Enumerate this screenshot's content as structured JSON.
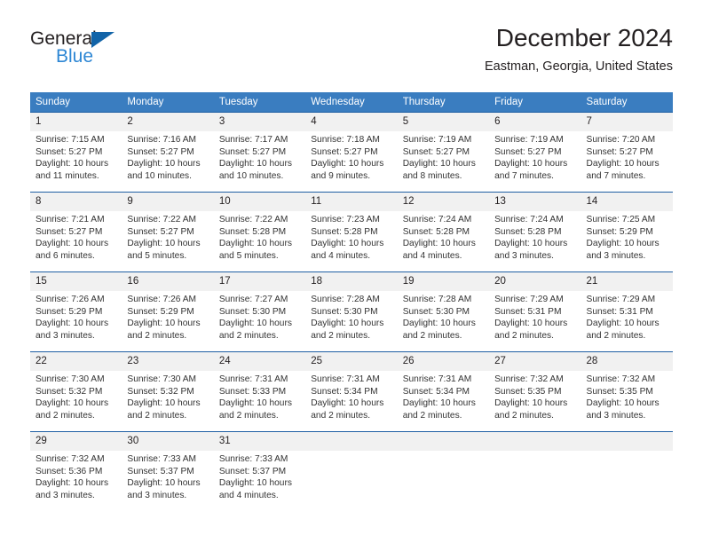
{
  "brand": {
    "name_part1": "General",
    "name_part2": "Blue",
    "logo_icon": "triangle-logo-icon",
    "accent_color": "#1264a8",
    "secondary_color": "#2e87d4"
  },
  "header": {
    "title": "December 2024",
    "location": "Eastman, Georgia, United States"
  },
  "calendar": {
    "header_bg_color": "#3a7dc0",
    "row_divider_color": "#1f5fa3",
    "daynum_bg_color": "#f1f1f1",
    "weekday_headers": [
      "Sunday",
      "Monday",
      "Tuesday",
      "Wednesday",
      "Thursday",
      "Friday",
      "Saturday"
    ],
    "weeks": [
      [
        {
          "day": "1",
          "sunrise": "Sunrise: 7:15 AM",
          "sunset": "Sunset: 5:27 PM",
          "daylight_line1": "Daylight: 10 hours",
          "daylight_line2": "and 11 minutes."
        },
        {
          "day": "2",
          "sunrise": "Sunrise: 7:16 AM",
          "sunset": "Sunset: 5:27 PM",
          "daylight_line1": "Daylight: 10 hours",
          "daylight_line2": "and 10 minutes."
        },
        {
          "day": "3",
          "sunrise": "Sunrise: 7:17 AM",
          "sunset": "Sunset: 5:27 PM",
          "daylight_line1": "Daylight: 10 hours",
          "daylight_line2": "and 10 minutes."
        },
        {
          "day": "4",
          "sunrise": "Sunrise: 7:18 AM",
          "sunset": "Sunset: 5:27 PM",
          "daylight_line1": "Daylight: 10 hours",
          "daylight_line2": "and 9 minutes."
        },
        {
          "day": "5",
          "sunrise": "Sunrise: 7:19 AM",
          "sunset": "Sunset: 5:27 PM",
          "daylight_line1": "Daylight: 10 hours",
          "daylight_line2": "and 8 minutes."
        },
        {
          "day": "6",
          "sunrise": "Sunrise: 7:19 AM",
          "sunset": "Sunset: 5:27 PM",
          "daylight_line1": "Daylight: 10 hours",
          "daylight_line2": "and 7 minutes."
        },
        {
          "day": "7",
          "sunrise": "Sunrise: 7:20 AM",
          "sunset": "Sunset: 5:27 PM",
          "daylight_line1": "Daylight: 10 hours",
          "daylight_line2": "and 7 minutes."
        }
      ],
      [
        {
          "day": "8",
          "sunrise": "Sunrise: 7:21 AM",
          "sunset": "Sunset: 5:27 PM",
          "daylight_line1": "Daylight: 10 hours",
          "daylight_line2": "and 6 minutes."
        },
        {
          "day": "9",
          "sunrise": "Sunrise: 7:22 AM",
          "sunset": "Sunset: 5:27 PM",
          "daylight_line1": "Daylight: 10 hours",
          "daylight_line2": "and 5 minutes."
        },
        {
          "day": "10",
          "sunrise": "Sunrise: 7:22 AM",
          "sunset": "Sunset: 5:28 PM",
          "daylight_line1": "Daylight: 10 hours",
          "daylight_line2": "and 5 minutes."
        },
        {
          "day": "11",
          "sunrise": "Sunrise: 7:23 AM",
          "sunset": "Sunset: 5:28 PM",
          "daylight_line1": "Daylight: 10 hours",
          "daylight_line2": "and 4 minutes."
        },
        {
          "day": "12",
          "sunrise": "Sunrise: 7:24 AM",
          "sunset": "Sunset: 5:28 PM",
          "daylight_line1": "Daylight: 10 hours",
          "daylight_line2": "and 4 minutes."
        },
        {
          "day": "13",
          "sunrise": "Sunrise: 7:24 AM",
          "sunset": "Sunset: 5:28 PM",
          "daylight_line1": "Daylight: 10 hours",
          "daylight_line2": "and 3 minutes."
        },
        {
          "day": "14",
          "sunrise": "Sunrise: 7:25 AM",
          "sunset": "Sunset: 5:29 PM",
          "daylight_line1": "Daylight: 10 hours",
          "daylight_line2": "and 3 minutes."
        }
      ],
      [
        {
          "day": "15",
          "sunrise": "Sunrise: 7:26 AM",
          "sunset": "Sunset: 5:29 PM",
          "daylight_line1": "Daylight: 10 hours",
          "daylight_line2": "and 3 minutes."
        },
        {
          "day": "16",
          "sunrise": "Sunrise: 7:26 AM",
          "sunset": "Sunset: 5:29 PM",
          "daylight_line1": "Daylight: 10 hours",
          "daylight_line2": "and 2 minutes."
        },
        {
          "day": "17",
          "sunrise": "Sunrise: 7:27 AM",
          "sunset": "Sunset: 5:30 PM",
          "daylight_line1": "Daylight: 10 hours",
          "daylight_line2": "and 2 minutes."
        },
        {
          "day": "18",
          "sunrise": "Sunrise: 7:28 AM",
          "sunset": "Sunset: 5:30 PM",
          "daylight_line1": "Daylight: 10 hours",
          "daylight_line2": "and 2 minutes."
        },
        {
          "day": "19",
          "sunrise": "Sunrise: 7:28 AM",
          "sunset": "Sunset: 5:30 PM",
          "daylight_line1": "Daylight: 10 hours",
          "daylight_line2": "and 2 minutes."
        },
        {
          "day": "20",
          "sunrise": "Sunrise: 7:29 AM",
          "sunset": "Sunset: 5:31 PM",
          "daylight_line1": "Daylight: 10 hours",
          "daylight_line2": "and 2 minutes."
        },
        {
          "day": "21",
          "sunrise": "Sunrise: 7:29 AM",
          "sunset": "Sunset: 5:31 PM",
          "daylight_line1": "Daylight: 10 hours",
          "daylight_line2": "and 2 minutes."
        }
      ],
      [
        {
          "day": "22",
          "sunrise": "Sunrise: 7:30 AM",
          "sunset": "Sunset: 5:32 PM",
          "daylight_line1": "Daylight: 10 hours",
          "daylight_line2": "and 2 minutes."
        },
        {
          "day": "23",
          "sunrise": "Sunrise: 7:30 AM",
          "sunset": "Sunset: 5:32 PM",
          "daylight_line1": "Daylight: 10 hours",
          "daylight_line2": "and 2 minutes."
        },
        {
          "day": "24",
          "sunrise": "Sunrise: 7:31 AM",
          "sunset": "Sunset: 5:33 PM",
          "daylight_line1": "Daylight: 10 hours",
          "daylight_line2": "and 2 minutes."
        },
        {
          "day": "25",
          "sunrise": "Sunrise: 7:31 AM",
          "sunset": "Sunset: 5:34 PM",
          "daylight_line1": "Daylight: 10 hours",
          "daylight_line2": "and 2 minutes."
        },
        {
          "day": "26",
          "sunrise": "Sunrise: 7:31 AM",
          "sunset": "Sunset: 5:34 PM",
          "daylight_line1": "Daylight: 10 hours",
          "daylight_line2": "and 2 minutes."
        },
        {
          "day": "27",
          "sunrise": "Sunrise: 7:32 AM",
          "sunset": "Sunset: 5:35 PM",
          "daylight_line1": "Daylight: 10 hours",
          "daylight_line2": "and 2 minutes."
        },
        {
          "day": "28",
          "sunrise": "Sunrise: 7:32 AM",
          "sunset": "Sunset: 5:35 PM",
          "daylight_line1": "Daylight: 10 hours",
          "daylight_line2": "and 3 minutes."
        }
      ],
      [
        {
          "day": "29",
          "sunrise": "Sunrise: 7:32 AM",
          "sunset": "Sunset: 5:36 PM",
          "daylight_line1": "Daylight: 10 hours",
          "daylight_line2": "and 3 minutes."
        },
        {
          "day": "30",
          "sunrise": "Sunrise: 7:33 AM",
          "sunset": "Sunset: 5:37 PM",
          "daylight_line1": "Daylight: 10 hours",
          "daylight_line2": "and 3 minutes."
        },
        {
          "day": "31",
          "sunrise": "Sunrise: 7:33 AM",
          "sunset": "Sunset: 5:37 PM",
          "daylight_line1": "Daylight: 10 hours",
          "daylight_line2": "and 4 minutes."
        },
        {
          "day": "",
          "sunrise": "",
          "sunset": "",
          "daylight_line1": "",
          "daylight_line2": ""
        },
        {
          "day": "",
          "sunrise": "",
          "sunset": "",
          "daylight_line1": "",
          "daylight_line2": ""
        },
        {
          "day": "",
          "sunrise": "",
          "sunset": "",
          "daylight_line1": "",
          "daylight_line2": ""
        },
        {
          "day": "",
          "sunrise": "",
          "sunset": "",
          "daylight_line1": "",
          "daylight_line2": ""
        }
      ]
    ]
  }
}
